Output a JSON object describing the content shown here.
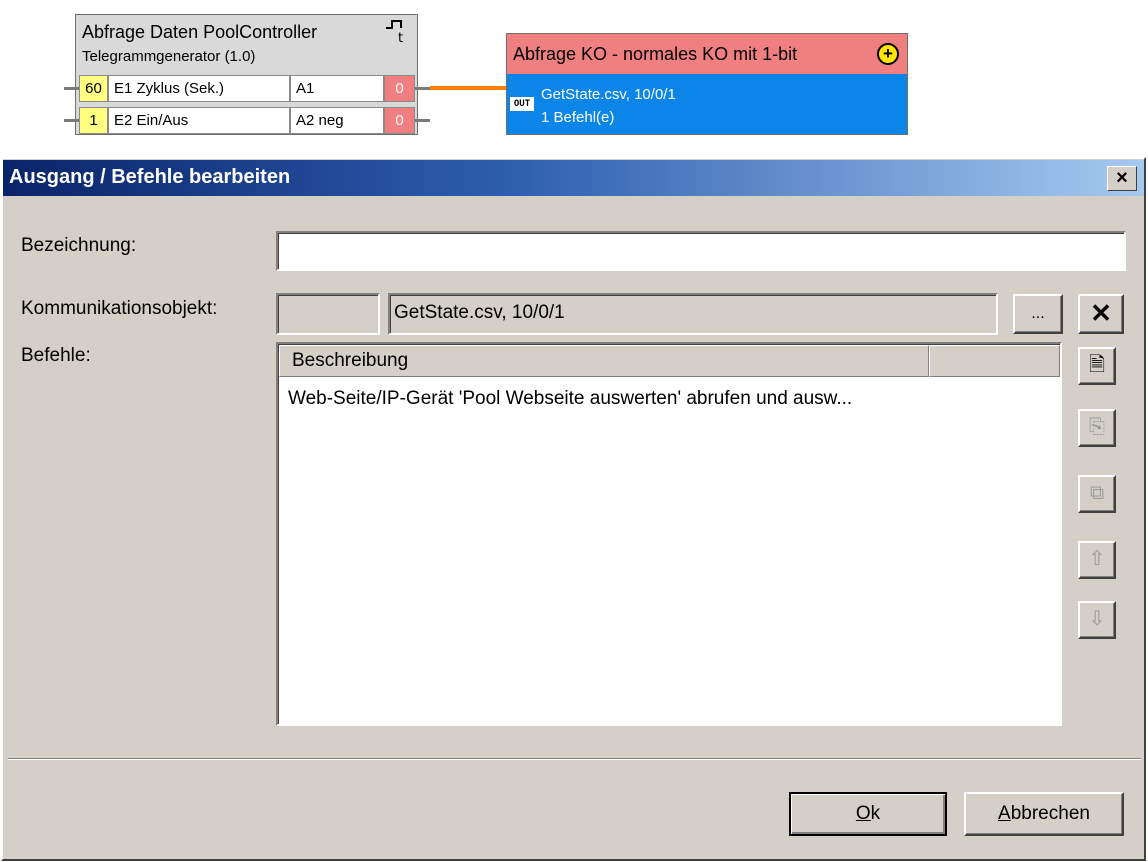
{
  "logic_block": {
    "title": "Abfrage Daten PoolController",
    "subtitle": "Telegrammgenerator (1.0)",
    "trigger_icon": "trigger-pulse-icon",
    "inputs": [
      {
        "value": "60",
        "label": "E1 Zyklus (Sek.)",
        "output": "A1",
        "out_value": "0"
      },
      {
        "value": "1",
        "label": "E2 Ein/Aus",
        "output": "A2 neg",
        "out_value": "0"
      }
    ]
  },
  "ko_node": {
    "title": "Abfrage KO - normales KO mit 1-bit",
    "tag": "OUT",
    "line1": "GetState.csv, 10/0/1",
    "line2": "1 Befehl(e)",
    "colors": {
      "head": "#f08080",
      "body": "#0b86e8",
      "wire": "#ff8000"
    }
  },
  "dialog": {
    "title": "Ausgang / Befehle bearbeiten",
    "close_label": "×",
    "labels": {
      "bezeichnung": "Bezeichnung:",
      "komm": "Kommunikationsobjekt:",
      "befehle": "Befehle:"
    },
    "bezeichnung_value": "",
    "komm_small_value": "",
    "komm_value": "GetState.csv, 10/0/1",
    "browse_label": "...",
    "remove_label": "✕",
    "list": {
      "columns": [
        "Beschreibung",
        ""
      ],
      "rows": [
        "Web-Seite/IP-Gerät 'Pool Webseite auswerten' abrufen und ausw..."
      ]
    },
    "side_buttons": [
      {
        "name": "new-command-button",
        "glyph": "🗎",
        "enabled": true
      },
      {
        "name": "edit-command-button",
        "glyph": "⎘",
        "enabled": false
      },
      {
        "name": "copy-command-button",
        "glyph": "⧉",
        "enabled": false
      },
      {
        "name": "move-up-button",
        "glyph": "⇧",
        "enabled": false
      },
      {
        "name": "move-down-button",
        "glyph": "⇩",
        "enabled": false
      }
    ],
    "ok_mnemonic": "O",
    "ok_rest": "k",
    "cancel_mnemonic": "A",
    "cancel_rest": "bbrechen"
  }
}
